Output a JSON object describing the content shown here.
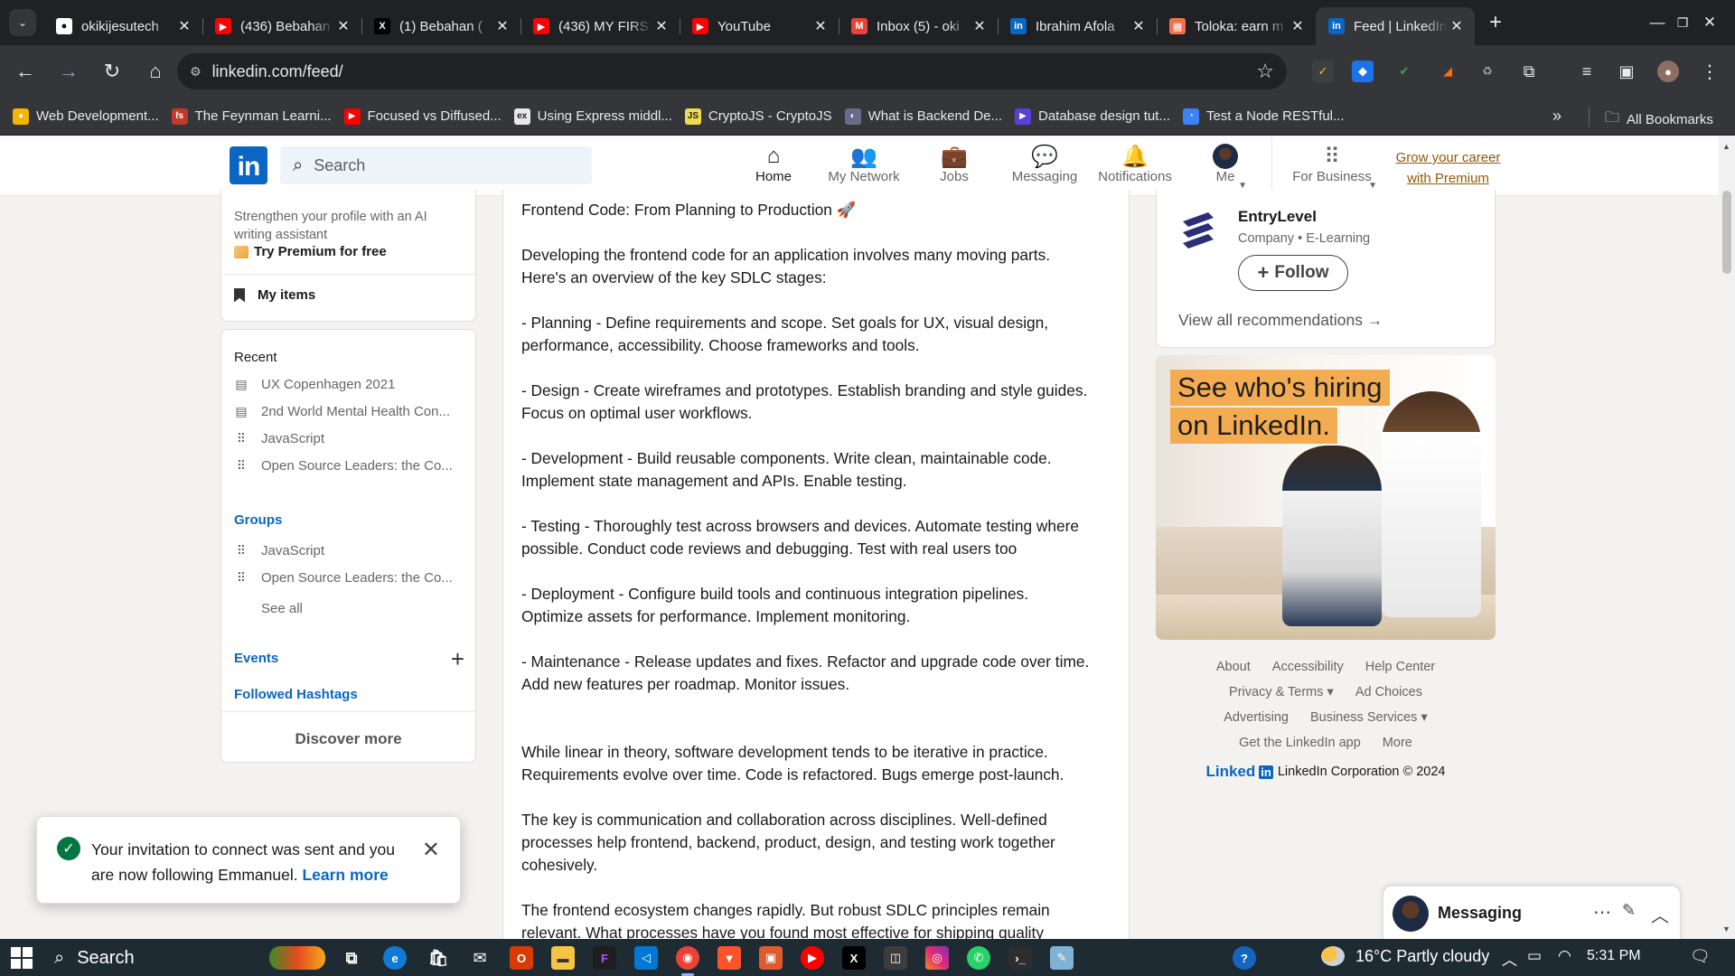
{
  "browser": {
    "tabs": [
      {
        "title": "okikijesutech",
        "favicon": "github-icon",
        "color": "#ffffff",
        "glyph": "●"
      },
      {
        "title": "(436) Bebahan",
        "favicon": "youtube-icon",
        "color": "#ff0000",
        "glyph": "▶"
      },
      {
        "title": "(1) Bebahan (",
        "favicon": "x-icon",
        "color": "#000000",
        "glyph": "X"
      },
      {
        "title": "(436) MY FIRST",
        "favicon": "youtube-icon",
        "color": "#ff0000",
        "glyph": "▶"
      },
      {
        "title": "YouTube",
        "favicon": "youtube-icon",
        "color": "#ff0000",
        "glyph": "▶"
      },
      {
        "title": "Inbox (5) - oki",
        "favicon": "gmail-icon",
        "color": "#ea4335",
        "glyph": "M"
      },
      {
        "title": "Ibrahim Afola",
        "favicon": "linkedin-icon",
        "color": "#0a66c2",
        "glyph": "in"
      },
      {
        "title": "Toloka: earn m",
        "favicon": "toloka-icon",
        "color": "#f2714c",
        "glyph": "▦"
      },
      {
        "title": "Feed | LinkedIn",
        "favicon": "linkedin-icon",
        "color": "#0a66c2",
        "glyph": "in"
      }
    ],
    "url": "linkedin.com/feed/",
    "bookmarks": [
      {
        "label": "Web Development...",
        "color": "#f5b400",
        "glyph": "●"
      },
      {
        "label": "The Feynman Learni...",
        "color": "#c0392b",
        "glyph": "fs"
      },
      {
        "label": "Focused vs Diffused...",
        "color": "#ff0000",
        "glyph": "▶"
      },
      {
        "label": "Using Express middl...",
        "color": "#e8e8e8",
        "glyph": "ex"
      },
      {
        "label": "CryptoJS - CryptoJS",
        "color": "#f0db4f",
        "glyph": "JS"
      },
      {
        "label": "What is Backend De...",
        "color": "#6a6a8a",
        "glyph": "◐"
      },
      {
        "label": "Database design tut...",
        "color": "#5b3fd6",
        "glyph": "▶"
      },
      {
        "label": "Test a Node RESTful...",
        "color": "#3b82f6",
        "glyph": "◔"
      }
    ],
    "all_bookmarks": "All Bookmarks"
  },
  "linkedin": {
    "search_placeholder": "Search",
    "nav": [
      {
        "label": "Home",
        "icon": "home-icon",
        "glyph": "⌂"
      },
      {
        "label": "My Network",
        "icon": "network-icon",
        "glyph": "👥"
      },
      {
        "label": "Jobs",
        "icon": "briefcase-icon",
        "glyph": "💼"
      },
      {
        "label": "Messaging",
        "icon": "chat-icon",
        "glyph": "💬"
      },
      {
        "label": "Notifications",
        "icon": "bell-icon",
        "glyph": "🔔"
      },
      {
        "label": "Me",
        "icon": "avatar-icon",
        "glyph": "●"
      },
      {
        "label": "For Business",
        "icon": "grid-icon",
        "glyph": "⠿"
      }
    ],
    "premium_link": "Grow your career with Premium"
  },
  "left": {
    "premium_hint": "Strengthen your profile with an AI writing assistant",
    "try_premium": "Try Premium for free",
    "my_items": "My items",
    "recent_title": "Recent",
    "recent": [
      {
        "label": "UX Copenhagen 2021",
        "icon": "calendar-icon"
      },
      {
        "label": "2nd World Mental Health Con...",
        "icon": "calendar-icon"
      },
      {
        "label": "JavaScript",
        "icon": "group-icon"
      },
      {
        "label": "Open Source Leaders: the Co...",
        "icon": "group-icon"
      }
    ],
    "groups_title": "Groups",
    "groups": [
      {
        "label": "JavaScript",
        "icon": "group-icon"
      },
      {
        "label": "Open Source Leaders: the Co...",
        "icon": "group-icon"
      }
    ],
    "see_all": "See all",
    "events": "Events",
    "followed_hashtags": "Followed Hashtags",
    "discover_more": "Discover more"
  },
  "post": {
    "body": "Frontend Code: From Planning to Production 🚀\n\nDeveloping the frontend code for an application involves many moving parts.\nHere's an overview of the key SDLC stages:\n\n- Planning - Define requirements and scope. Set goals for UX, visual design,\nperformance, accessibility. Choose frameworks and tools.\n\n- Design - Create wireframes and prototypes. Establish branding and style guides.\nFocus on optimal user workflows.\n\n- Development - Build reusable components. Write clean, maintainable code.\nImplement state management and APIs. Enable testing.\n\n- Testing - Thoroughly test across browsers and devices. Automate testing where\npossible. Conduct code reviews and debugging. Test with real users too\n\n- Deployment - Configure build tools and continuous integration pipelines.\nOptimize assets for performance. Implement monitoring.\n\n- Maintenance - Release updates and fixes. Refactor and upgrade code over time.\nAdd new features per roadmap. Monitor issues.\n\n\nWhile linear in theory, software development tends to be iterative in practice.\nRequirements evolve over time. Code is refactored. Bugs emerge post-launch.\n\nThe key is communication and collaboration across disciplines. Well-defined\nprocesses help frontend, backend, product, design, and testing work together\ncohesively.\n\nThe frontend ecosystem changes rapidly. But robust SDLC principles remain\nrelevant. What processes have you found most effective for shipping quality"
  },
  "right": {
    "company_name": "EntryLevel",
    "company_meta": "Company • E-Learning",
    "follow": "Follow",
    "view_all": "View all recommendations →",
    "ad_line1": "See who's hiring",
    "ad_line2": "on LinkedIn.",
    "footer_rows": [
      [
        "About",
        "Accessibility",
        "Help Center"
      ],
      [
        "Privacy & Terms ▾",
        "Ad Choices"
      ],
      [
        "Advertising",
        "Business Services ▾"
      ],
      [
        "Get the LinkedIn app",
        "More"
      ]
    ],
    "corp_logo_word": "Linked",
    "corp_logo_box": "in",
    "corp": "LinkedIn Corporation © 2024"
  },
  "toast": {
    "message": "Your invitation to connect was sent and you are now following Emmanuel.",
    "link": "Learn more"
  },
  "messaging": {
    "title": "Messaging"
  },
  "taskbar": {
    "search": "Search",
    "weather": "16°C  Partly cloudy",
    "time": "5:31 PM"
  }
}
